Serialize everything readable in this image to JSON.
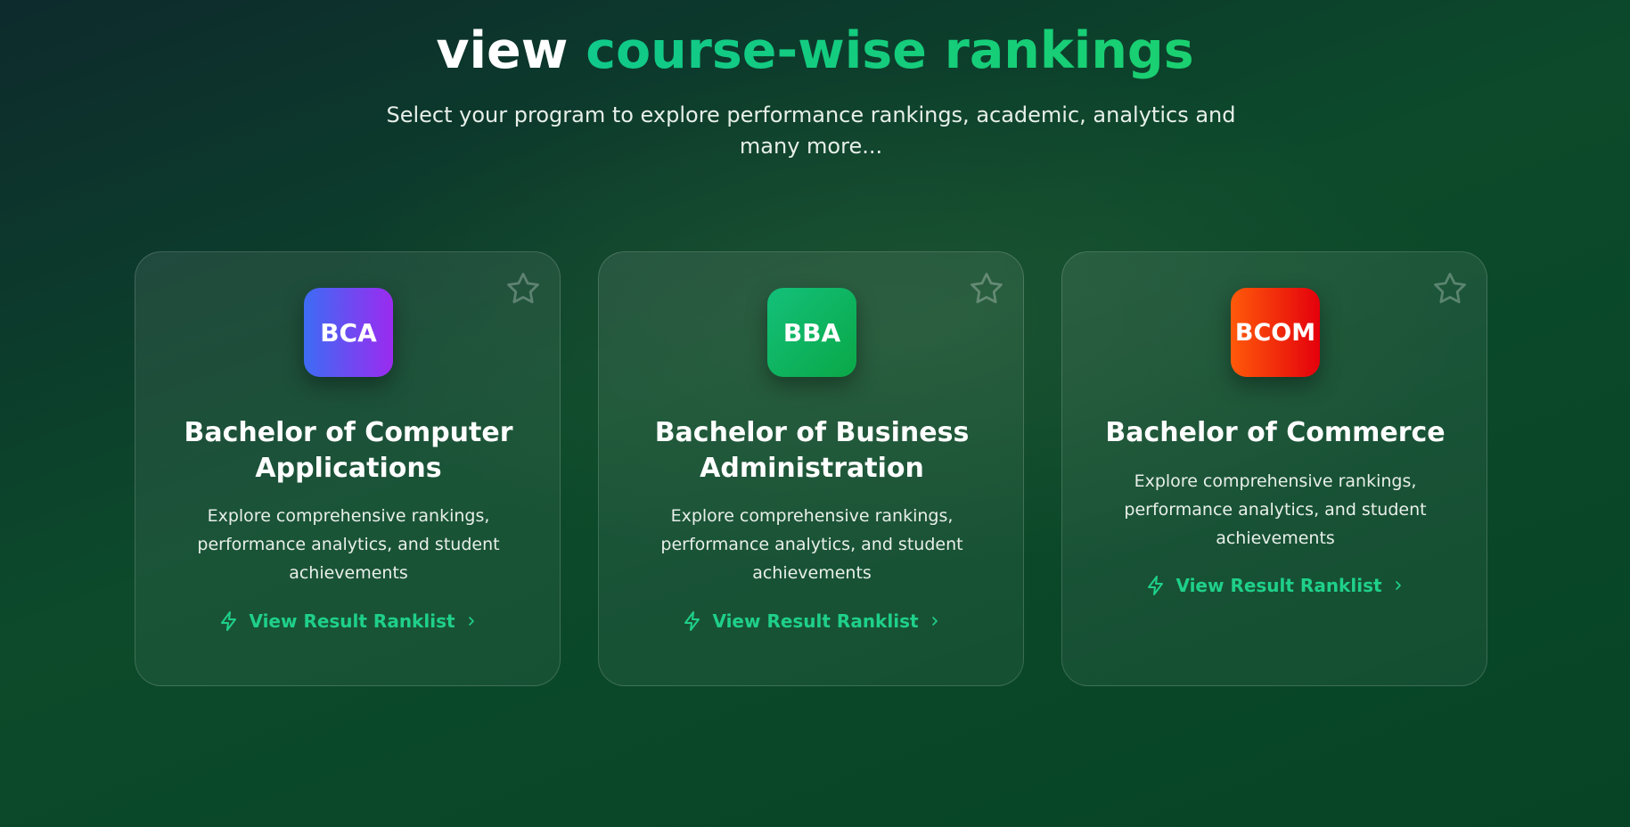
{
  "heading": {
    "part1": "view",
    "part2": "course-wise rankings"
  },
  "subtitle": "Select your program to explore performance rankings, academic, analytics and many more...",
  "colors": {
    "accent": "#1fd08a",
    "bca_badge": [
      "#3d6cf4",
      "#9b2bf0"
    ],
    "bba_badge": [
      "#13c07a",
      "#0aa847"
    ],
    "bcom_badge": [
      "#ff5a0a",
      "#e4000c"
    ]
  },
  "courses": [
    {
      "badge": "BCA",
      "title": "Bachelor of Computer Applications",
      "description": "Explore comprehensive rankings, performance analytics, and student achievements",
      "link_label": "View Result Ranklist",
      "icons": [
        "star-icon",
        "lightning-icon",
        "chevron-right-icon"
      ]
    },
    {
      "badge": "BBA",
      "title": "Bachelor of Business Administration",
      "description": "Explore comprehensive rankings, performance analytics, and student achievements",
      "link_label": "View Result Ranklist",
      "icons": [
        "star-icon",
        "lightning-icon",
        "chevron-right-icon"
      ]
    },
    {
      "badge": "BCOM",
      "title": "Bachelor of Commerce",
      "description": "Explore comprehensive rankings, performance analytics, and student achievements",
      "link_label": "View Result Ranklist",
      "icons": [
        "star-icon",
        "lightning-icon",
        "chevron-right-icon"
      ]
    }
  ]
}
